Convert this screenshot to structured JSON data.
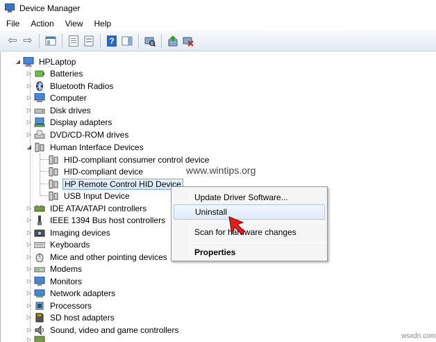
{
  "window": {
    "title": "Device Manager"
  },
  "menu": [
    "File",
    "Action",
    "View",
    "Help"
  ],
  "tree": {
    "root": "HPLaptop",
    "categories": [
      {
        "label": "Batteries",
        "icon": "battery-icon",
        "expanded": false
      },
      {
        "label": "Bluetooth Radios",
        "icon": "bluetooth-icon",
        "expanded": false
      },
      {
        "label": "Computer",
        "icon": "computer-icon",
        "expanded": false
      },
      {
        "label": "Disk drives",
        "icon": "disk-drive-icon",
        "expanded": false
      },
      {
        "label": "Display adapters",
        "icon": "display-adapter-icon",
        "expanded": false
      },
      {
        "label": "DVD/CD-ROM drives",
        "icon": "dvd-drive-icon",
        "expanded": false
      },
      {
        "label": "Human Interface Devices",
        "icon": "hid-icon",
        "expanded": true
      },
      {
        "label": "IDE ATA/ATAPI controllers",
        "icon": "ide-controller-icon",
        "expanded": false
      },
      {
        "label": "IEEE 1394 Bus host controllers",
        "icon": "ieee1394-icon",
        "expanded": false
      },
      {
        "label": "Imaging devices",
        "icon": "camera-icon",
        "expanded": false
      },
      {
        "label": "Keyboards",
        "icon": "keyboard-icon",
        "expanded": false
      },
      {
        "label": "Mice and other pointing devices",
        "icon": "mouse-icon",
        "expanded": false
      },
      {
        "label": "Modems",
        "icon": "modem-icon",
        "expanded": false
      },
      {
        "label": "Monitors",
        "icon": "monitor-icon",
        "expanded": false
      },
      {
        "label": "Network adapters",
        "icon": "network-adapter-icon",
        "expanded": false
      },
      {
        "label": "Processors",
        "icon": "processor-icon",
        "expanded": false
      },
      {
        "label": "SD host adapters",
        "icon": "sd-adapter-icon",
        "expanded": false
      },
      {
        "label": "Sound, video and game controllers",
        "icon": "speaker-icon",
        "expanded": false
      }
    ],
    "hid_children": [
      "HID-compliant consumer control device",
      "HID-compliant device",
      "HP Remote Control HID Device",
      "USB Input Device"
    ],
    "selected": "HP Remote Control HID Device"
  },
  "context_menu": {
    "items": [
      "Update Driver Software...",
      "Uninstall",
      "Scan for hardware changes",
      "Properties"
    ],
    "hovered": "Uninstall"
  },
  "watermark": "www.wintips.org",
  "corner_watermark": "wsxdn.com",
  "colors": {
    "selection": "#d6e6f8",
    "accent": "#2a64c8",
    "cursor_arrow": "#e02020"
  }
}
